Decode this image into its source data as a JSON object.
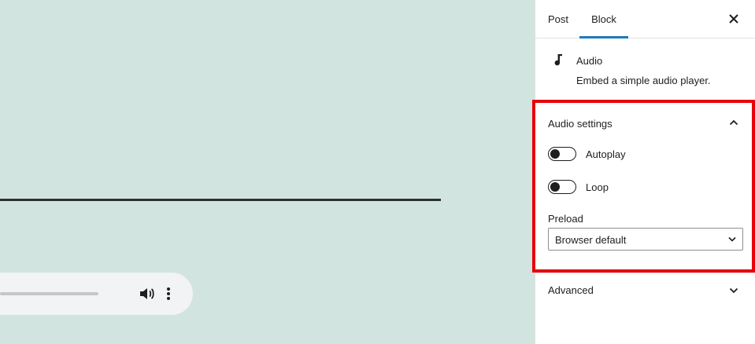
{
  "tabs": {
    "post": "Post",
    "block": "Block"
  },
  "block": {
    "title": "Audio",
    "description": "Embed a simple audio player."
  },
  "audio_settings": {
    "title": "Audio settings",
    "autoplay": {
      "label": "Autoplay",
      "checked": false
    },
    "loop": {
      "label": "Loop",
      "checked": false
    },
    "preload": {
      "label": "Preload",
      "selected": "Browser default"
    }
  },
  "advanced": {
    "title": "Advanced"
  },
  "colors": {
    "accent": "#1e7ab8",
    "highlight": "#e8000b",
    "canvas": "#d2e4df"
  }
}
